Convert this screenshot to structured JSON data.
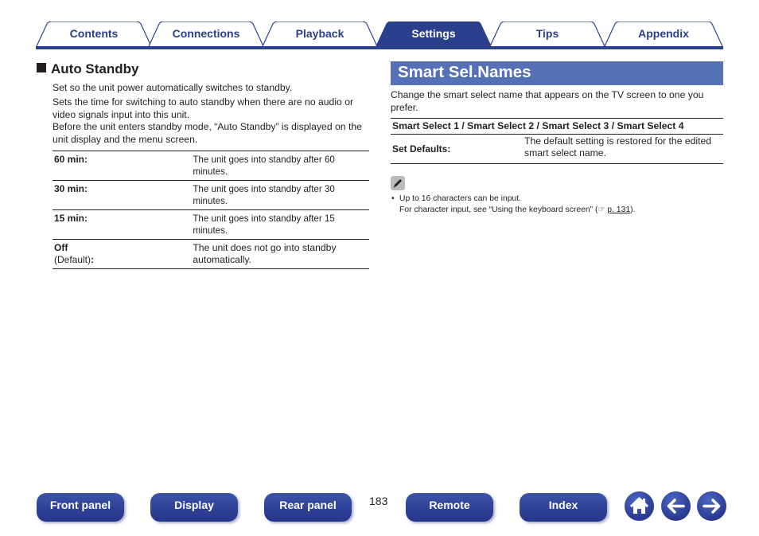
{
  "tabs": [
    {
      "label": "Contents",
      "active": false
    },
    {
      "label": "Connections",
      "active": false
    },
    {
      "label": "Playback",
      "active": false
    },
    {
      "label": "Settings",
      "active": true
    },
    {
      "label": "Tips",
      "active": false
    },
    {
      "label": "Appendix",
      "active": false
    }
  ],
  "auto_standby": {
    "heading": "Auto Standby",
    "paragraphs": [
      "Set so the unit power automatically switches to standby.",
      "Sets the time for switching to auto standby when there are no audio or video signals input into this unit.",
      "Before the unit enters standby mode, “Auto Standby” is displayed on the unit display and the menu screen."
    ],
    "options": [
      {
        "key": "60 min:",
        "value": "The unit goes into standby after 60 minutes."
      },
      {
        "key": "30 min:",
        "value": "The unit goes into standby after 30 minutes."
      },
      {
        "key": "15 min:",
        "value": "The unit goes into standby after 15 minutes."
      },
      {
        "key": "Off",
        "key_sub": "(Default)",
        "key_colon": ":",
        "value": "The unit does not go into standby automatically."
      }
    ]
  },
  "smart_sel": {
    "title": "Smart Sel.Names",
    "description": "Change the smart select name that appears on the TV screen to one you prefer.",
    "row_header": "Smart Select 1 / Smart Select 2 / Smart Select 3 / Smart Select 4",
    "option_key": "Set Defaults:",
    "option_value": "The default setting is restored for the edited smart select name.",
    "note_bullet": "•",
    "note_line1": "Up to 16 characters can be input.",
    "note_line2_pre": "For character input, see “Using the keyboard screen” (",
    "note_link": "p. 131",
    "note_line2_post": ")."
  },
  "footer": {
    "buttons": [
      "Front panel",
      "Display",
      "Rear panel",
      "Remote",
      "Index"
    ],
    "page_number": "183",
    "icons": [
      "home-icon",
      "back-arrow-icon",
      "forward-arrow-icon"
    ]
  },
  "colors": {
    "accent": "#2b3f8c",
    "banner": "#5670b5"
  }
}
